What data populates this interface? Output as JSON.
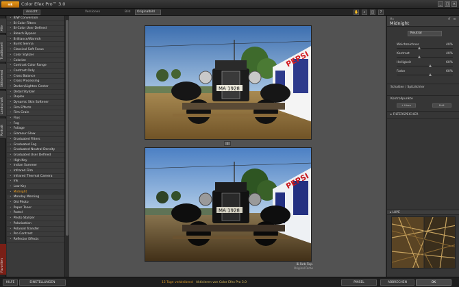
{
  "window": {
    "logo_text": "nik",
    "title": "Color Efex Pro™ 3.0",
    "controls": [
      "_",
      "□",
      "×"
    ]
  },
  "toolbar": {
    "btn_left": "Ansicht",
    "version_label": "Versionen",
    "mode_label": "Bild",
    "mode_value": "Originalbild",
    "icons": [
      "hand-icon",
      "zoom-icon",
      "compare-icon",
      "help-icon"
    ]
  },
  "tabs": [
    {
      "label": "Alle",
      "active": false
    },
    {
      "label": "Traditionell",
      "active": false
    },
    {
      "label": "Stilisierend",
      "active": false
    },
    {
      "label": "Landschaft",
      "active": false
    },
    {
      "label": "Portrait",
      "active": false
    },
    {
      "label": "Favoriten",
      "active": true
    }
  ],
  "filters": [
    "B/W Conversion",
    "Bi-Color Filters",
    "Bi-Color User Defined",
    "Bleach Bypass",
    "Brilliance/Warmth",
    "Burnt Sienna",
    "Classical Soft Focus",
    "Color Stylizer",
    "Colorize",
    "Contrast Color Range",
    "Contrast Only",
    "Cross Balance",
    "Cross Processing",
    "Darken/Lighten Center",
    "Detail Stylizer",
    "Duplex",
    "Dynamic Skin Softener",
    "Film Effects",
    "Film Grain",
    "Flux",
    "Fog",
    "Foliage",
    "Glamour Glow",
    "Graduated Filters",
    "Graduated Fog",
    "Graduated Neutral Density",
    "Graduated User Defined",
    "High Key",
    "Indian Summer",
    "Infrared Film",
    "Infrared Thermal Camera",
    "Ink",
    "Low Key",
    "Midnight",
    "Monday Morning",
    "Old Photo",
    "Paper Toner",
    "Pastel",
    "Photo Stylizer",
    "Polarization",
    "Polaroid Transfer",
    "Pro Contrast",
    "Reflector Effects"
  ],
  "selected_filter": "Midnight",
  "preview": {
    "caption_line1": "Bi-Farb Fixp.",
    "caption_line2": "Original Farbe"
  },
  "panel": {
    "subtitle": "Mo",
    "title": "Midnight",
    "color_select": "Neutral",
    "sliders": [
      {
        "label": "Weichzeichner",
        "value": "40%",
        "level": 0.4
      },
      {
        "label": "Kontrast",
        "value": "40%",
        "level": 0.4
      },
      {
        "label": "Helligkeit",
        "value": "60%",
        "level": 0.6
      },
      {
        "label": "Farbe",
        "value": "60%",
        "level": 0.6
      }
    ],
    "section_shadows": "Schatten / Spitzlichter",
    "section_control": "Kontrollpunkte",
    "btn_add": "+ Hinzu",
    "btn_remove": "Entf.",
    "section_filter": "▸ FILTERSPEICHER",
    "loupe_label": "▸ LUPE"
  },
  "bottom": {
    "help": "HILFE",
    "settings": "EINSTELLUNGEN",
    "trial_days": "15 Tage verbleibend",
    "trial_link": "Aktivieren von Color Efex Pro 3.0",
    "brush": "PINSEL",
    "cancel": "ABBRECHEN",
    "ok": "OK"
  },
  "colors": {
    "accent": "#e3a02a",
    "tab_active": "#7a1f16",
    "panel_bg": "#363636"
  }
}
